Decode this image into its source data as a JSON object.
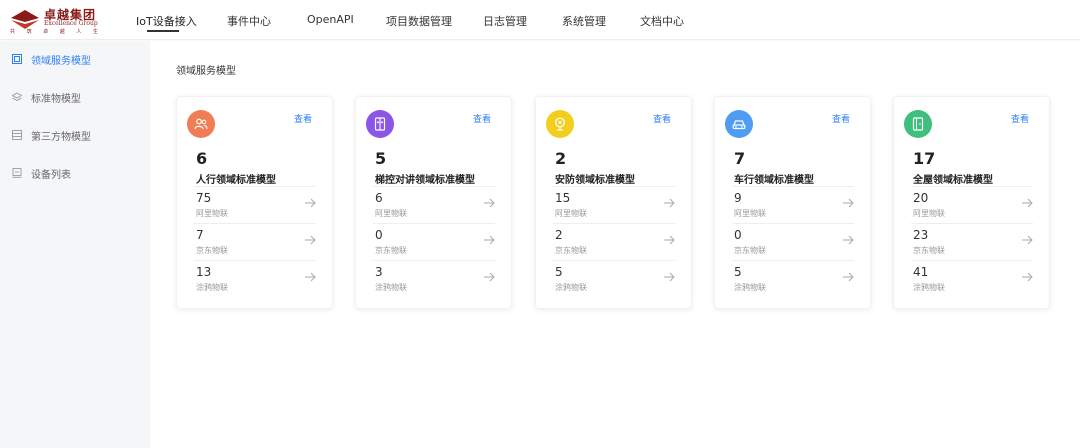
{
  "brand": {
    "name_cn": "卓越集团",
    "name_en": "Excellence Group",
    "slogan": "共 筑 卓 越 人 生",
    "color": "#8b1a1a"
  },
  "nav": {
    "items": [
      {
        "label": "IoT设备接入",
        "active": true
      },
      {
        "label": "事件中心"
      },
      {
        "label": "OpenAPI"
      },
      {
        "label": "项目数据管理"
      },
      {
        "label": "日志管理"
      },
      {
        "label": "系统管理"
      },
      {
        "label": "文档中心"
      }
    ]
  },
  "sidebar": {
    "items": [
      {
        "label": "领域服务模型",
        "icon": "model-icon",
        "active": true
      },
      {
        "label": "标准物模型",
        "icon": "layers-icon"
      },
      {
        "label": "第三方物模型",
        "icon": "list-icon"
      },
      {
        "label": "设备列表",
        "icon": "device-icon"
      }
    ]
  },
  "main": {
    "title": "领域服务模型",
    "view_label": "查看",
    "cards": [
      {
        "count": "6",
        "name": "人行领域标准模型",
        "icon": "person-icon",
        "color": "#ef7d55",
        "rows": [
          {
            "value": "75",
            "label": "阿里物联"
          },
          {
            "value": "7",
            "label": "京东物联"
          },
          {
            "value": "13",
            "label": "涂鸦物联"
          }
        ]
      },
      {
        "count": "5",
        "name": "梯控对讲领域标准模型",
        "icon": "elevator-icon",
        "color": "#8b55e8",
        "rows": [
          {
            "value": "6",
            "label": "阿里物联"
          },
          {
            "value": "0",
            "label": "京东物联"
          },
          {
            "value": "3",
            "label": "涂鸦物联"
          }
        ]
      },
      {
        "count": "2",
        "name": "安防领域标准模型",
        "icon": "camera-icon",
        "color": "#f2cf1f",
        "rows": [
          {
            "value": "15",
            "label": "阿里物联"
          },
          {
            "value": "2",
            "label": "京东物联"
          },
          {
            "value": "5",
            "label": "涂鸦物联"
          }
        ]
      },
      {
        "count": "7",
        "name": "车行领域标准模型",
        "icon": "car-icon",
        "color": "#4f9cf2",
        "rows": [
          {
            "value": "9",
            "label": "阿里物联"
          },
          {
            "value": "0",
            "label": "京东物联"
          },
          {
            "value": "5",
            "label": "涂鸦物联"
          }
        ]
      },
      {
        "count": "17",
        "name": "全屋领域标准模型",
        "icon": "door-icon",
        "color": "#3fbf7c",
        "rows": [
          {
            "value": "20",
            "label": "阿里物联"
          },
          {
            "value": "23",
            "label": "京东物联"
          },
          {
            "value": "41",
            "label": "涂鸦物联"
          }
        ]
      }
    ]
  }
}
